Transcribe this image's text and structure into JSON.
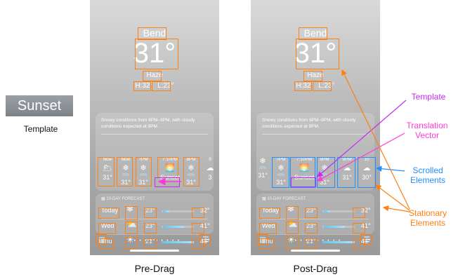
{
  "template_panel": {
    "image_text": "Sunset",
    "caption": "Template"
  },
  "captions": {
    "pre": "Pre-Drag",
    "post": "Post-Drag"
  },
  "weather": {
    "city": "Bend",
    "temp": "31°",
    "condition": "Haze",
    "high": "H:32°",
    "low": "L:23°",
    "summary": "Snowy conditions from 6PM–9PM, with cloudy conditions expected at 9PM.",
    "forecast_header": "10-DAY FORECAST",
    "days": [
      {
        "day": "Today",
        "icon": "snow-icon",
        "glyph": "❄",
        "pct": "70%",
        "lo": "23°",
        "hi": "32°",
        "fill_start": 0.05,
        "fill_end": 0.25
      },
      {
        "day": "Wed",
        "icon": "partly-cloudy-icon",
        "glyph": "⛅",
        "pct": "",
        "lo": "23°",
        "hi": "41°",
        "fill_start": 0.05,
        "fill_end": 0.7
      },
      {
        "day": "Thu",
        "icon": "sun-icon",
        "glyph": "☀",
        "pct": "",
        "lo": "21°",
        "hi": "46°",
        "fill_start": 0.0,
        "fill_end": 1.0
      }
    ]
  },
  "pre_hours": [
    {
      "label": "Now",
      "glyph": "🌥",
      "pct": "",
      "temp": "31°",
      "icon": "haze-icon"
    },
    {
      "label": "Now",
      "glyph": "❄",
      "pct": "20%",
      "temp": "31°",
      "icon": "snow-icon"
    },
    {
      "label": "7PM",
      "glyph": "❄",
      "pct": "40%",
      "temp": "31°",
      "icon": "snow-icon"
    },
    {
      "label": "7:10PM",
      "glyph": "🌅",
      "pct": "",
      "temp": "Sunset",
      "icon": "sunset-icon"
    },
    {
      "label": "8PM",
      "glyph": "❄",
      "pct": "40%",
      "temp": "31°",
      "icon": "snow-icon"
    },
    {
      "label": "9",
      "glyph": "☁",
      "pct": "",
      "temp": "3",
      "icon": "cloud-icon"
    }
  ],
  "post_hours": [
    {
      "label": "",
      "glyph": "❄",
      "pct": "20%",
      "temp": "31°",
      "icon": "snow-icon"
    },
    {
      "label": "7PM",
      "glyph": "❄",
      "pct": "40%",
      "temp": "31°",
      "icon": "snow-icon"
    },
    {
      "label": "7:10PM",
      "glyph": "🌅",
      "pct": "",
      "temp": "Sunset",
      "icon": "sunset-icon"
    },
    {
      "label": "8PM",
      "glyph": "❄",
      "pct": "40%",
      "temp": "31°",
      "icon": "snow-icon"
    },
    {
      "label": "9PM",
      "glyph": "☁",
      "pct": "",
      "temp": "31°",
      "icon": "cloud-icon"
    },
    {
      "label": "10",
      "glyph": "☁",
      "pct": "",
      "temp": "30°",
      "icon": "cloud-icon"
    }
  ],
  "legend": {
    "template": "Template",
    "translation": "Translation\nVector",
    "scrolled": "Scrolled\nElements",
    "stationary": "Stationary\nElements"
  },
  "colors": {
    "stationary": "#ff7f11",
    "scrolled": "#1e90ff",
    "template": "#c42cf2",
    "translation": "#ff3ad8"
  }
}
